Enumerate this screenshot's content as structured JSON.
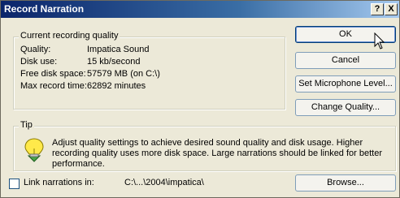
{
  "window": {
    "title": "Record Narration",
    "help_button": "?",
    "close_button": "X"
  },
  "quality_group": {
    "legend": "Current recording quality",
    "rows": [
      {
        "label": "Quality:",
        "value": "Impatica Sound"
      },
      {
        "label": "Disk use:",
        "value": "15 kb/second"
      },
      {
        "label": "Free disk space:",
        "value": "57579 MB (on C:\\)"
      },
      {
        "label": "Max record time:",
        "value": "62892 minutes"
      }
    ]
  },
  "buttons": {
    "ok": "OK",
    "cancel": "Cancel",
    "set_mic": "Set Microphone Level...",
    "change_quality": "Change Quality...",
    "browse": "Browse..."
  },
  "tip_group": {
    "legend": "Tip",
    "icon": "lightbulb-icon",
    "text": "Adjust quality settings to achieve desired sound quality and disk usage. Higher recording quality uses more disk space. Large narrations should be linked for better performance."
  },
  "link": {
    "label": "Link narrations in:",
    "path": "C:\\...\\2004\\impatica\\",
    "checked": false
  },
  "colors": {
    "title_bar_start": "#0a246a",
    "title_bar_end": "#a6caf0",
    "dialog_bg": "#ece9d8"
  }
}
